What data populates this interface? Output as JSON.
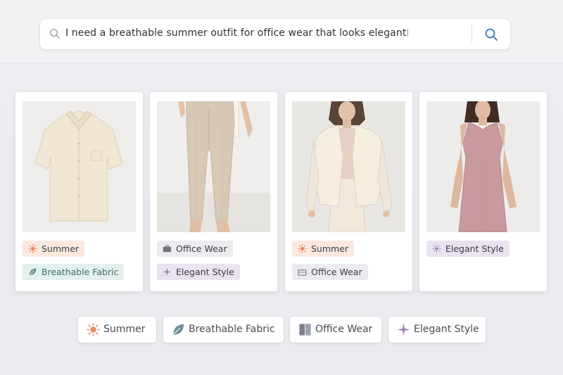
{
  "search": {
    "query": "I need a breathable summer outfit for office wear that looks elegant",
    "cursor": "|"
  },
  "products": [
    {
      "image": "linen-shirt",
      "tags": [
        {
          "label": "Summer",
          "icon": "sun-icon"
        },
        {
          "label": "Breathable Fabric",
          "icon": "leaf-icon"
        }
      ]
    },
    {
      "image": "beige-trousers",
      "tags": [
        {
          "label": "Office Wear",
          "icon": "briefcase-icon"
        },
        {
          "label": "Elegant Style",
          "icon": "sparkle-icon"
        }
      ]
    },
    {
      "image": "cream-blazer-outfit",
      "tags": [
        {
          "label": "Summer",
          "icon": "sun-icon"
        },
        {
          "label": "Office Wear",
          "icon": "briefcase-icon"
        }
      ]
    },
    {
      "image": "pink-sheath-dress",
      "tags": [
        {
          "label": "Elegant Style",
          "icon": "sparkle-icon"
        }
      ]
    }
  ],
  "filters": [
    {
      "label": "Summer",
      "icon": "sun-icon"
    },
    {
      "label": "Breathable Fabric",
      "icon": "leaf-icon"
    },
    {
      "label": "Office Wear",
      "icon": "briefcase-icon"
    },
    {
      "label": "Elegant Style",
      "icon": "sparkle-icon"
    }
  ],
  "colors": {
    "summer": "#e8895e",
    "breathable": "#5f958c",
    "office": "#7a7f8c",
    "elegant": "#9b82b5",
    "search_button": "#3a78b5"
  }
}
